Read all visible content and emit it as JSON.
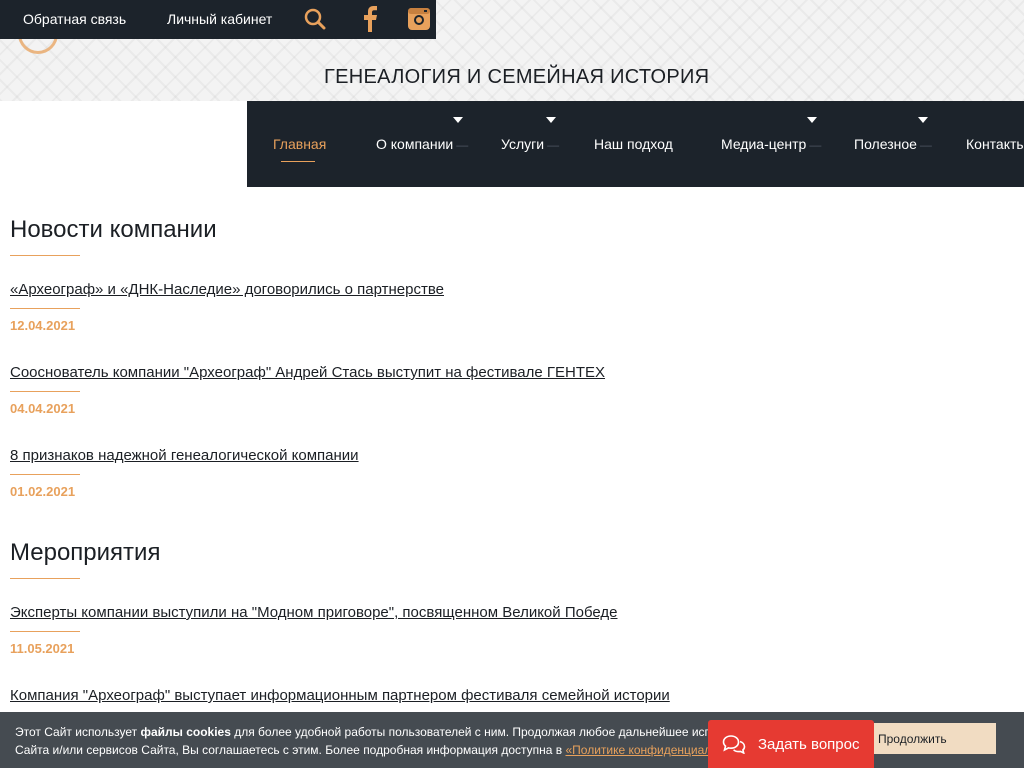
{
  "topbar": {
    "feedback_label": "Обратная связь",
    "cabinet_label": "Личный кабинет",
    "icons": [
      "search-icon",
      "facebook-icon",
      "instagram-icon"
    ],
    "accent_color": "#e8a15c"
  },
  "site_title": "ГЕНЕАЛОГИЯ И СЕМЕЙНАЯ ИСТОРИЯ",
  "nav": {
    "items": [
      {
        "label": "Главная",
        "active": true,
        "has_dropdown": false
      },
      {
        "label": "О компании",
        "active": false,
        "has_dropdown": true
      },
      {
        "label": "Услуги",
        "active": false,
        "has_dropdown": true
      },
      {
        "label": "Наш подход",
        "active": false,
        "has_dropdown": false
      },
      {
        "label": "Медиа-центр",
        "active": false,
        "has_dropdown": true
      },
      {
        "label": "Полезное",
        "active": false,
        "has_dropdown": true
      },
      {
        "label": "Контакты",
        "active": false,
        "has_dropdown": false
      }
    ],
    "background_color": "#1c232b"
  },
  "news": {
    "heading": "Новости компании",
    "items": [
      {
        "title": "«Археограф» и «ДНК-Наследие» договорились о партнерстве",
        "date": "12.04.2021"
      },
      {
        "title": "Сооснователь компании \"Археограф\" Андрей Стась выступит на фестивале ГЕНТЕХ",
        "date": "04.04.2021"
      },
      {
        "title": "8 признаков надежной генеалогической компании",
        "date": "01.02.2021"
      }
    ]
  },
  "events": {
    "heading": "Мероприятия",
    "items": [
      {
        "title": "Эксперты компании выступили на \"Модном приговоре\", посвященном Великой Победе",
        "date": "11.05.2021"
      },
      {
        "title": "Компания \"Археограф\" выступает информационным партнером фестиваля семейной истории",
        "date": ""
      }
    ]
  },
  "cookie": {
    "line1_start": "Этот Сайт использует ",
    "line1_bold": "файлы cookies",
    "line1_end": " для более удобной работы пользователей с ним. Продолжая любое дальнейшее использование",
    "line2_start": "Сайта и/или сервисов Сайта, Вы соглашаетесь с этим. Более подробная информация доступна в ",
    "line2_link": "«Политике конфиденциальности»",
    "continue_label": "Продолжить"
  },
  "ask_button": {
    "label": "Задать вопрос",
    "icon": "chat-icon",
    "color": "#e63a32"
  }
}
